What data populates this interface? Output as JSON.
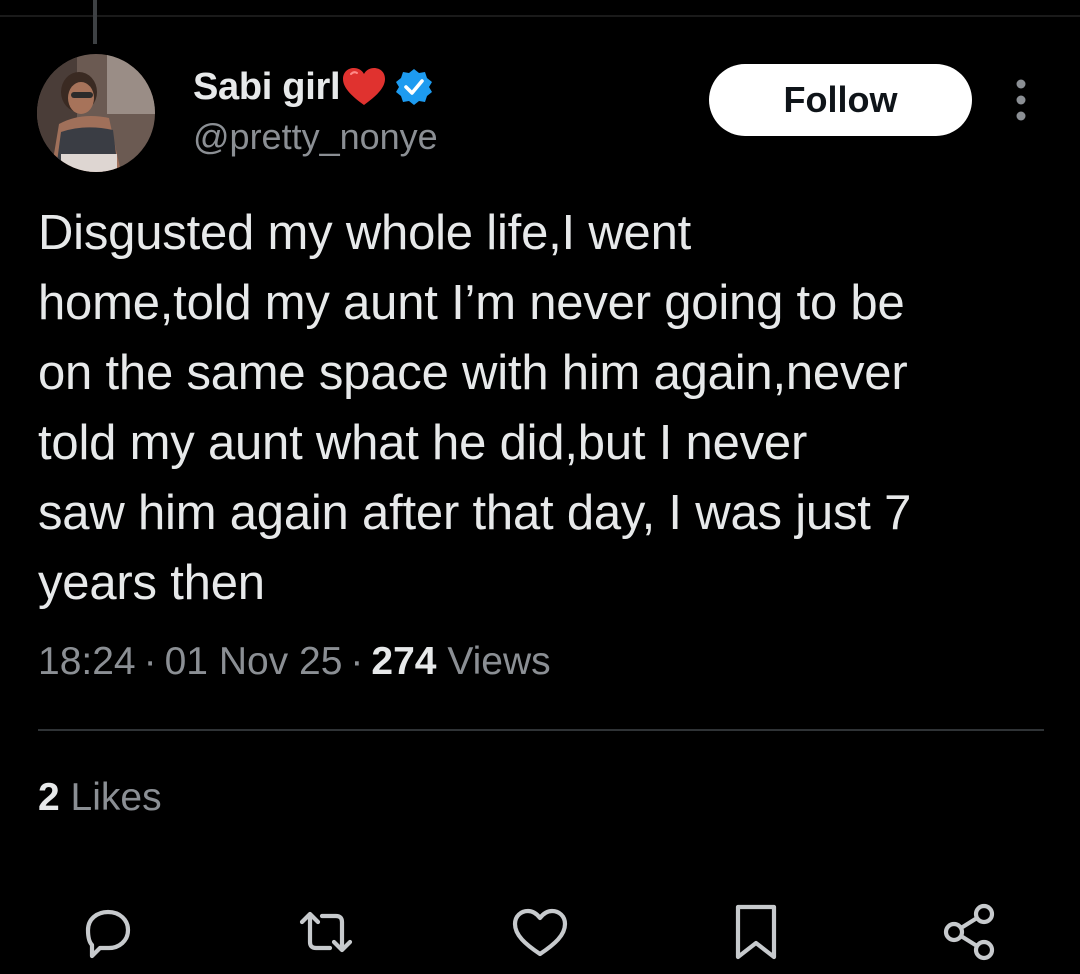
{
  "author": {
    "display_name": "Sabi girl",
    "handle": "@pretty_nonye",
    "avatar_icon": "avatar-photo",
    "name_emoji": "red-heart",
    "verified_color": "#1d9bf0"
  },
  "header": {
    "follow_label": "Follow",
    "more_icon": "more-vertical-icon"
  },
  "tweet": {
    "text": "Disgusted my whole life,I went\nhome,told my aunt I’m never going to be\non the same space with him again,never\ntold my aunt what he did,but I never\nsaw him again after that day, I was just 7\nyears then"
  },
  "meta": {
    "time": "18:24",
    "date": "01 Nov 25",
    "views_count": "274",
    "views_label": " Views",
    "separator": "·"
  },
  "engagement": {
    "likes_count": "2",
    "likes_label": " Likes"
  },
  "actions": [
    {
      "icon": "reply-icon"
    },
    {
      "icon": "retweet-icon"
    },
    {
      "icon": "like-icon"
    },
    {
      "icon": "bookmark-icon"
    },
    {
      "icon": "share-icon"
    }
  ],
  "colors": {
    "background": "#000000",
    "primary_text": "#e7e9ea",
    "secondary_text": "#8b8f94",
    "icon": "#c7cacd",
    "heart": "#e0322f"
  }
}
